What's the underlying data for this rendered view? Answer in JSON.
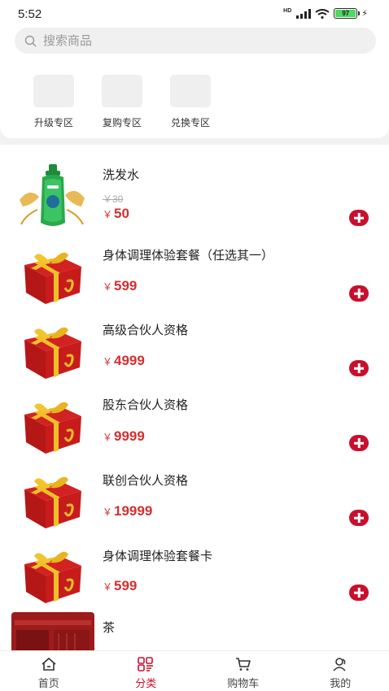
{
  "status_bar": {
    "time": "5:52",
    "network": "HD",
    "battery": "97"
  },
  "search": {
    "placeholder": "搜索商品"
  },
  "zones": [
    {
      "label": "升级专区"
    },
    {
      "label": "复购专区"
    },
    {
      "label": "兑换专区"
    }
  ],
  "products": [
    {
      "name": "洗发水",
      "original_price": "￥30",
      "currency": "￥",
      "price": "50",
      "image": "shampoo-bottle"
    },
    {
      "name": "身体调理体验套餐（任选其一）",
      "currency": "￥",
      "price": "599",
      "image": "gift-box"
    },
    {
      "name": "高级合伙人资格",
      "currency": "￥",
      "price": "4999",
      "image": "gift-box"
    },
    {
      "name": "股东合伙人资格",
      "currency": "￥",
      "price": "9999",
      "image": "gift-box"
    },
    {
      "name": "联创合伙人资格",
      "currency": "￥",
      "price": "19999",
      "image": "gift-box"
    },
    {
      "name": "身体调理体验套餐卡",
      "currency": "￥",
      "price": "599",
      "image": "gift-box"
    },
    {
      "name": "茶",
      "image": "tea-shop-banner"
    }
  ],
  "tabbar": [
    {
      "label": "首页",
      "icon": "home-icon"
    },
    {
      "label": "分类",
      "icon": "category-icon",
      "active": true
    },
    {
      "label": "购物车",
      "icon": "cart-icon"
    },
    {
      "label": "我的",
      "icon": "user-icon"
    }
  ],
  "colors": {
    "accent": "#c8102e",
    "price": "#d32f2f",
    "battery": "#4cd964"
  }
}
